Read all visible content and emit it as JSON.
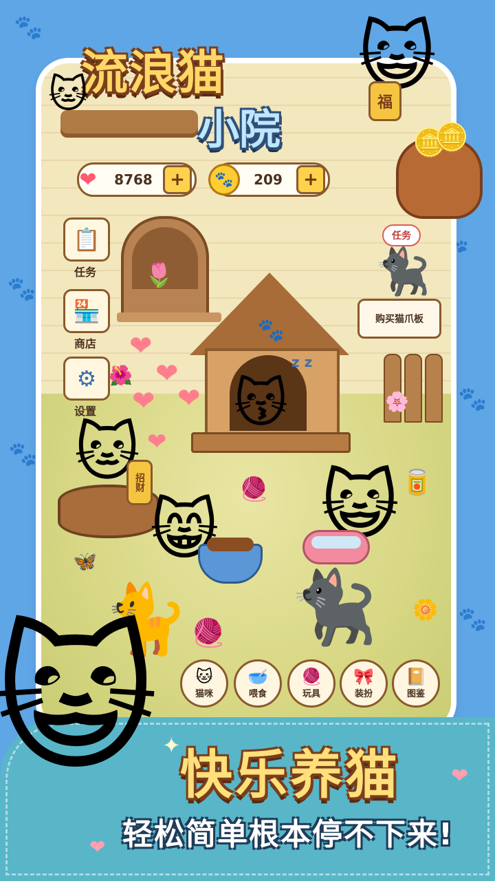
{
  "title": {
    "line1": "流浪猫",
    "line2": "小院"
  },
  "resources": {
    "hearts": {
      "icon": "heart-icon",
      "value": "8768",
      "plus": "+"
    },
    "coins": {
      "icon": "paw-coin-icon",
      "value": "209",
      "plus": "+"
    }
  },
  "side_menu": [
    {
      "icon": "clipboard-icon",
      "label": "任务"
    },
    {
      "icon": "shop-icon",
      "label": "商店"
    },
    {
      "icon": "gear-icon",
      "label": "设置"
    }
  ],
  "task_popup": {
    "tag": "任务",
    "sign": "购买猫爪板"
  },
  "lucky_cat": {
    "charm": "福"
  },
  "yard_cat_charm": "招财",
  "bottom_nav": [
    {
      "icon": "cat-face-icon",
      "label": "猫咪"
    },
    {
      "icon": "food-bowl-icon",
      "label": "喂食"
    },
    {
      "icon": "yarn-ball-icon",
      "label": "玩具"
    },
    {
      "icon": "bow-icon",
      "label": "装扮"
    },
    {
      "icon": "book-icon",
      "label": "图鉴"
    }
  ],
  "sleep_text": "z z",
  "slogan": {
    "main": "快乐养猫",
    "sub": "轻松简单根本停不下来!"
  },
  "colors": {
    "background": "#5fa6e6",
    "banner": "#58b6c8",
    "title_gold": "#ffd766",
    "title_blue": "#bde7ff"
  }
}
